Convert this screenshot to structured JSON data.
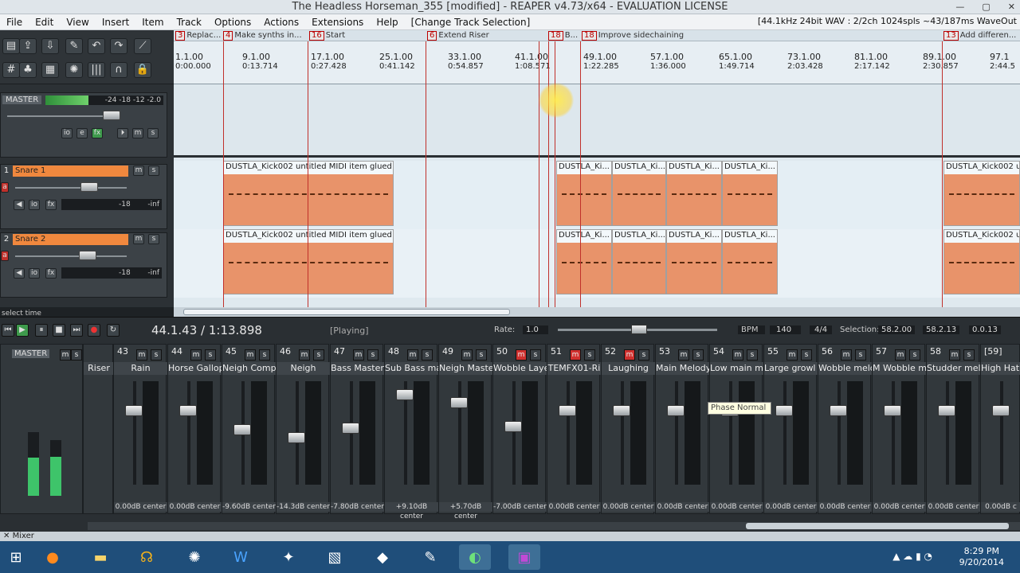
{
  "window": {
    "title": "The Headless Horseman_355 [modified] - REAPER v4.73/x64 - EVALUATION LICENSE"
  },
  "menu": {
    "items": [
      "File",
      "Edit",
      "View",
      "Insert",
      "Item",
      "Track",
      "Options",
      "Actions",
      "Extensions",
      "Help",
      "[Change Track Selection]"
    ],
    "status": "[44.1kHz 24bit WAV : 2/2ch 1024spls ~43/187ms WaveOut"
  },
  "regions": [
    {
      "num": "3",
      "label": "Replac..."
    },
    {
      "num": "4",
      "label": "Make synths in..."
    },
    {
      "num": "16",
      "label": "Start"
    },
    {
      "num": "6",
      "label": "Extend Riser"
    },
    {
      "num": "18",
      "label": "B..."
    },
    {
      "num": "18",
      "label": "Improve sidechaining"
    },
    {
      "num": "13",
      "label": "Add differen..."
    }
  ],
  "ruler": {
    "ticks": [
      {
        "bar": "1.1.00",
        "time": "0:00.000"
      },
      {
        "bar": "9.1.00",
        "time": "0:13.714"
      },
      {
        "bar": "17.1.00",
        "time": "0:27.428"
      },
      {
        "bar": "25.1.00",
        "time": "0:41.142"
      },
      {
        "bar": "33.1.00",
        "time": "0:54.857"
      },
      {
        "bar": "41.1.00",
        "time": "1:08.571"
      },
      {
        "bar": "49.1.00",
        "time": "1:22.285"
      },
      {
        "bar": "57.1.00",
        "time": "1:36.000"
      },
      {
        "bar": "65.1.00",
        "time": "1:49.714"
      },
      {
        "bar": "73.1.00",
        "time": "2:03.428"
      },
      {
        "bar": "81.1.00",
        "time": "2:17.142"
      },
      {
        "bar": "89.1.00",
        "time": "2:30.857"
      },
      {
        "bar": "97.1",
        "time": "2:44.5"
      }
    ]
  },
  "master": {
    "label": "MASTER",
    "meter": "-24 -18 -12 -2.0"
  },
  "tracks": [
    {
      "num": "1",
      "name": "Snare 1",
      "vol": "-18",
      "peak": "-inf",
      "item_full": "DUSTLA_Kick002 untitled MIDI item glued",
      "item_short": "DUSTLA_Ki...",
      "item_tail": "DUSTLA_Kick002 u"
    },
    {
      "num": "2",
      "name": "Snare 2",
      "vol": "-18",
      "peak": "-inf",
      "item_full": "DUSTLA_Kick002 untitled MIDI item glued",
      "item_short": "DUSTLA_Ki...",
      "item_tail": "DUSTLA_Kick002 u"
    }
  ],
  "transport": {
    "position": "44.1.43 / 1:13.898",
    "state": "[Playing]",
    "rate_label": "Rate:",
    "rate": "1.0",
    "bpm_label": "BPM",
    "bpm": "140",
    "sig": "4/4",
    "sel_label": "Selection:",
    "sel_start": "58.2.00",
    "sel_end": "58.2.13",
    "sel_len": "0.0.13",
    "select_time": "select time"
  },
  "mixer": {
    "master_label": "MASTER",
    "first": "Riser",
    "strips": [
      {
        "num": "43",
        "name": "Rain",
        "db": "0.00dB center"
      },
      {
        "num": "44",
        "name": "Horse Gallop",
        "db": "0.00dB center"
      },
      {
        "num": "45",
        "name": "Neigh Comp",
        "db": "-9.60dB center"
      },
      {
        "num": "46",
        "name": "Neigh",
        "db": "-14.3dB center"
      },
      {
        "num": "47",
        "name": "Bass Master",
        "db": "-7.80dB center"
      },
      {
        "num": "48",
        "name": "Sub Bass mas",
        "db": "+9.10dB center"
      },
      {
        "num": "49",
        "name": "Neigh Master",
        "db": "+5.70dB center"
      },
      {
        "num": "50",
        "name": "Wobble Laye",
        "db": "-7.00dB center"
      },
      {
        "num": "51",
        "name": "TEMFX01-Ri",
        "db": "0.00dB center"
      },
      {
        "num": "52",
        "name": "Laughing",
        "db": "0.00dB center"
      },
      {
        "num": "53",
        "name": "Main Melody",
        "db": "0.00dB center"
      },
      {
        "num": "54",
        "name": "Low main mel",
        "db": "0.00dB center"
      },
      {
        "num": "55",
        "name": "Large growl m",
        "db": "0.00dB center"
      },
      {
        "num": "56",
        "name": "Wobble melo",
        "db": "0.00dB center"
      },
      {
        "num": "57",
        "name": "M Wobble m",
        "db": "0.00dB center"
      },
      {
        "num": "58",
        "name": "Studder melo",
        "db": "0.00dB center"
      },
      {
        "num": "[59]",
        "name": "High Hat m",
        "db": "0.00dB c"
      }
    ],
    "tooltip": "Phase Normal",
    "tab": "Mixer"
  },
  "taskbar": {
    "time": "8:29 PM",
    "date": "9/20/2014"
  },
  "colors": {
    "item": "#e8936a",
    "trackname": "#f0883e",
    "accent": "#d0302e"
  }
}
